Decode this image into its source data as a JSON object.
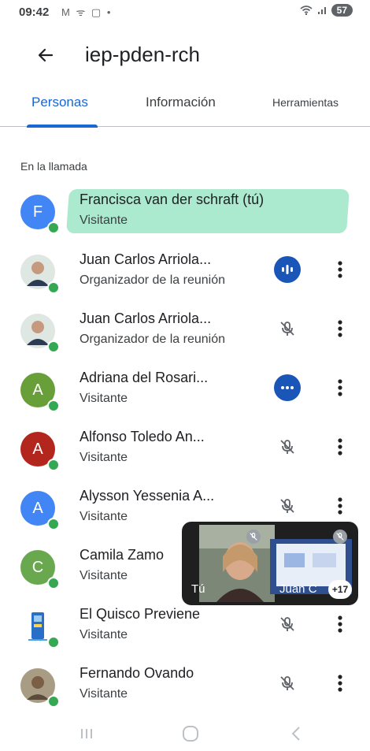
{
  "status": {
    "time": "09:42",
    "left_icons": "M ᯤ ▢ •",
    "battery": "57"
  },
  "app_bar": {
    "title": "iep-pden-rch"
  },
  "tabs": [
    {
      "label": "Personas",
      "active": true
    },
    {
      "label": "Información",
      "active": false
    },
    {
      "label": "Herramientas",
      "active": false
    }
  ],
  "section_title": "En la llamada",
  "participants": [
    {
      "name": "Francisca van der schraft (tú)",
      "role": "Visitante",
      "initial": "F",
      "avatar_color": "#4285f4",
      "audio": "none"
    },
    {
      "name": "Juan Carlos Arriola...",
      "role": "Organizador de la reunión",
      "initial": "",
      "avatar_color": "#c9d6cf",
      "audio": "speaking"
    },
    {
      "name": "Juan Carlos Arriola...",
      "role": "Organizador de la reunión",
      "initial": "",
      "avatar_color": "#c9d6cf",
      "audio": "muted"
    },
    {
      "name": "Adriana del Rosari...",
      "role": "Visitante",
      "initial": "A",
      "avatar_color": "#689f38",
      "audio": "active"
    },
    {
      "name": "Alfonso Toledo An...",
      "role": "Visitante",
      "initial": "A",
      "avatar_color": "#b3261e",
      "audio": "muted"
    },
    {
      "name": "Alysson Yessenia A...",
      "role": "Visitante",
      "initial": "A",
      "avatar_color": "#4285f4",
      "audio": "muted"
    },
    {
      "name": "Camila Zamo",
      "role": "Visitante",
      "initial": "C",
      "avatar_color": "#6aa84f",
      "audio": "none"
    },
    {
      "name": "El Quisco Previene",
      "role": "Visitante",
      "initial": "",
      "avatar_color": "#e8f0fe",
      "audio": "muted"
    },
    {
      "name": "Fernando Ovando",
      "role": "Visitante",
      "initial": "",
      "avatar_color": "#8a7f6a",
      "audio": "muted"
    }
  ],
  "floating": {
    "self_label": "Tú",
    "other_label": "Juan C",
    "overflow_count": "+17"
  }
}
